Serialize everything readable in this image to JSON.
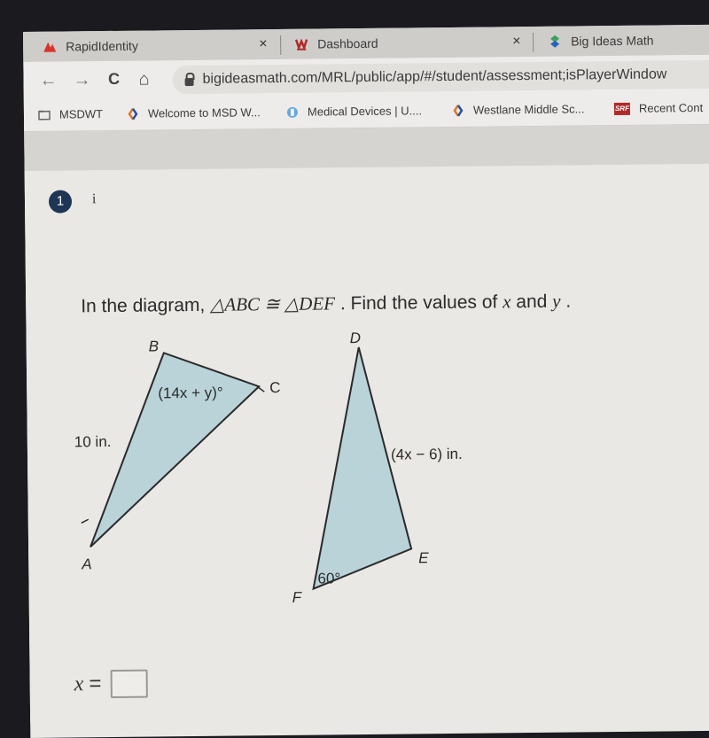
{
  "browser": {
    "tabs": [
      {
        "title": "RapidIdentity",
        "icon": "rapididentity-logo-icon",
        "close": "×"
      },
      {
        "title": "Dashboard",
        "icon": "dashboard-logo-icon",
        "close": "×"
      },
      {
        "title": "Big Ideas Math",
        "icon": "big-ideas-math-logo-icon"
      }
    ],
    "nav": {
      "back": "←",
      "forward": "→",
      "reload": "C",
      "home": "⌂"
    },
    "url": "bigideasmath.com/MRL/public/app/#/student/assessment;isPlayerWindow",
    "bookmarks": [
      {
        "label": "MSDWT",
        "icon": "folder-icon"
      },
      {
        "label": "Welcome to MSD W...",
        "icon": "msd-logo-icon"
      },
      {
        "label": "Medical Devices | U....",
        "icon": "medical-devices-icon"
      },
      {
        "label": "Westlane Middle Sc...",
        "icon": "msd-logo-icon"
      },
      {
        "label": "Recent Cont",
        "icon": "srf-logo-icon",
        "icon_text": "SRF"
      }
    ]
  },
  "question": {
    "number": "1",
    "info": "i",
    "prompt_start": "In the diagram, ",
    "triangle1": "△ABC",
    "congruent": " ≅ ",
    "triangle2": "△DEF",
    "prompt_mid": " . Find the values of ",
    "var_x": "x",
    "and": " and ",
    "var_y": "y",
    "prompt_end": " ."
  },
  "diagram": {
    "fill_color": "#b9d3d9",
    "stroke_color": "#2a2a2a",
    "triangle_abc": {
      "labels": {
        "A": "A",
        "B": "B",
        "C": "C"
      },
      "side_ab": "10 in.",
      "angle_b": "(14x + y)°"
    },
    "triangle_def": {
      "labels": {
        "D": "D",
        "E": "E",
        "F": "F"
      },
      "side_de": "(4x − 6) in.",
      "angle_f": "60°"
    }
  },
  "answer": {
    "variable": "x",
    "equals": "=",
    "value": ""
  }
}
